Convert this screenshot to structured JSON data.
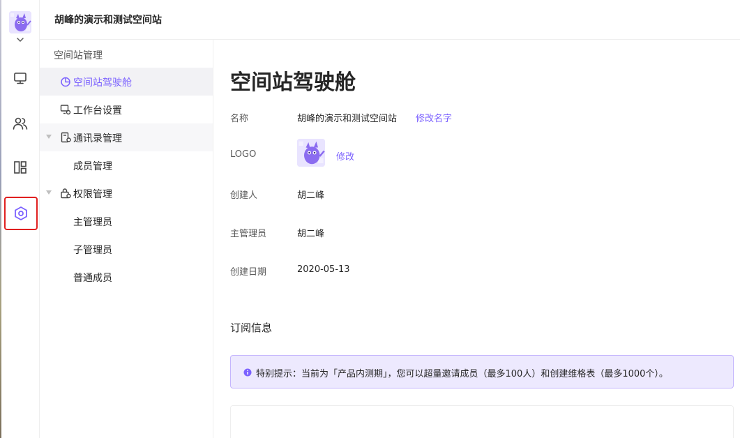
{
  "header": {
    "title": "胡峰的演示和测试空间站"
  },
  "subnav": {
    "group_title": "空间站管理",
    "items": [
      {
        "label": "空间站驾驶舱",
        "icon": "pie-chart-icon",
        "selected": true
      },
      {
        "label": "工作台设置",
        "icon": "workbench-icon"
      },
      {
        "label": "通讯录管理",
        "icon": "contacts-icon",
        "expanded": true
      },
      {
        "label": "成员管理"
      },
      {
        "label": "权限管理",
        "icon": "lock-icon",
        "expanded": true
      },
      {
        "label": "主管理员"
      },
      {
        "label": "子管理员"
      },
      {
        "label": "普通成员"
      }
    ]
  },
  "main": {
    "title": "空间站驾驶舱",
    "fields": {
      "name_label": "名称",
      "name_value": "胡峰的演示和测试空间站",
      "rename_link": "修改名字",
      "logo_label": "LOGO",
      "logo_edit_link": "修改",
      "creator_label": "创建人",
      "creator_value": "胡二峰",
      "admin_label": "主管理员",
      "admin_value": "胡二峰",
      "created_label": "创建日期",
      "created_value": "2020-05-13"
    },
    "subscription_title": "订阅信息",
    "notice_text": "特别提示：当前为「产品内测期」，您可以超量邀请成员（最多100人）和创建维格表（最多1000个）。"
  },
  "colors": {
    "accent": "#7b61ff",
    "highlight_border": "#e02020",
    "notice_bg": "#ede9fe"
  }
}
